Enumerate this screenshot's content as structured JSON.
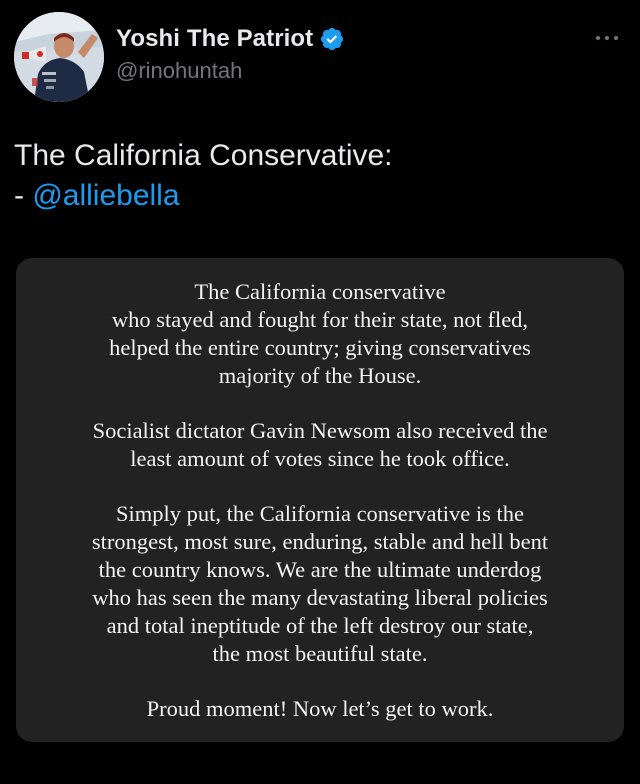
{
  "author": {
    "display_name": "Yoshi The Patriot",
    "handle": "@rinohuntah",
    "verified": true,
    "avatar_icon": "profile-photo-icon"
  },
  "more_icon": "more-options-icon",
  "tweet": {
    "line1": "The California Conservative:",
    "line2_prefix": "- ",
    "mention": "@alliebella"
  },
  "media_image": {
    "paragraphs": [
      {
        "lines": [
          "The California conservative",
          "who stayed and fought for their state, not fled,",
          "helped the entire country; giving conservatives",
          "majority of the House."
        ]
      },
      {
        "lines": [
          "Socialist dictator Gavin Newsom also received the",
          "least amount of votes since he took office."
        ]
      },
      {
        "lines": [
          "Simply put, the California conservative is the",
          "strongest, most sure, enduring, stable and hell bent",
          "the country knows. We are the ultimate underdog",
          "who has seen the many devastating liberal policies",
          "and total ineptitude of the left destroy our state,",
          "the most beautiful state."
        ]
      },
      {
        "lines": [
          "Proud moment! Now let’s get to work."
        ]
      }
    ]
  },
  "colors": {
    "background": "#000000",
    "text_primary": "#e7e9ea",
    "text_secondary": "#71767b",
    "link": "#1d9bf0",
    "verified_badge": "#1d9bf0",
    "media_background": "#222222"
  }
}
